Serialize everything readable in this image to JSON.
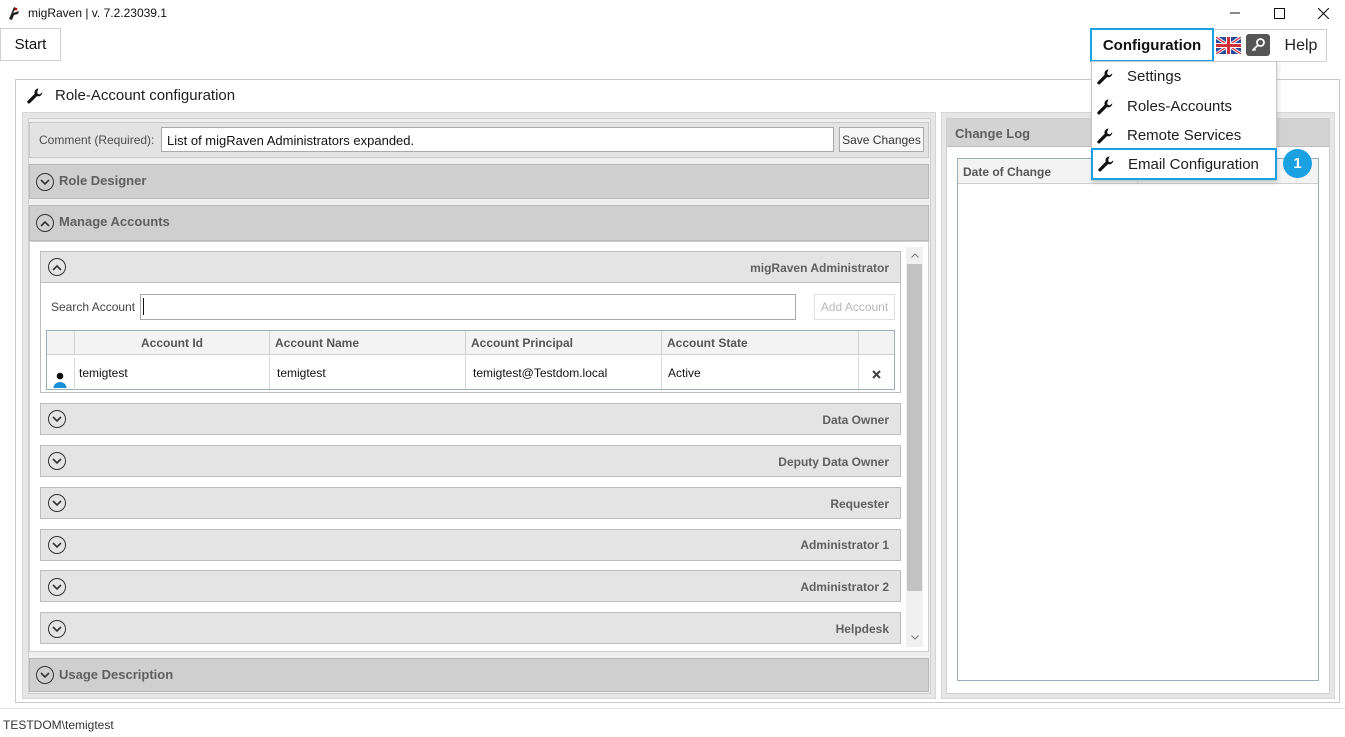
{
  "window": {
    "title": "migRaven | v. 7.2.23039.1",
    "controls": [
      "minimize-icon",
      "maximize-icon",
      "close-icon"
    ]
  },
  "toolbar": {
    "start_label": "Start",
    "configuration_label": "Configuration",
    "language_icon": "uk-flag-icon",
    "key_icon": "key-icon",
    "help_label": "Help"
  },
  "config_menu": {
    "items": [
      {
        "label": "Settings",
        "icon": "wrench-icon"
      },
      {
        "label": "Roles-Accounts",
        "icon": "wrench-icon"
      },
      {
        "label": "Remote Services",
        "icon": "wrench-icon"
      },
      {
        "label": "Email Configuration",
        "icon": "wrench-icon",
        "highlighted": true
      }
    ],
    "step_badge": "1"
  },
  "page": {
    "title": "Role-Account configuration",
    "icon": "wrench-icon"
  },
  "comment": {
    "label": "Comment (Required):",
    "value": "List of migRaven Administrators expanded.",
    "save_label": "Save Changes"
  },
  "sections": {
    "role_designer": "Role Designer",
    "manage_accounts": "Manage Accounts",
    "usage_description": "Usage Description"
  },
  "account_groups": {
    "expanded": {
      "title": "migRaven Administrator",
      "search_label": "Search Account",
      "search_value": "",
      "add_label": "Add Account",
      "columns": [
        "Account Id",
        "Account Name",
        "Account Principal",
        "Account State"
      ],
      "rows": [
        {
          "id": "temigtest",
          "name": "temigtest",
          "principal": "temigtest@Testdom.local",
          "state": "Active",
          "icon": "user-icon",
          "action_icon": "remove-icon"
        }
      ]
    },
    "collapsed": [
      "Data Owner",
      "Deputy Data Owner",
      "Requester",
      "Administrator 1",
      "Administrator 2",
      "Helpdesk"
    ]
  },
  "change_log": {
    "title": "Change Log",
    "columns": [
      "Date of Change",
      ""
    ]
  },
  "status": {
    "user": "TESTDOM\\temigtest"
  },
  "colors": {
    "accent": "#1ba1e2",
    "section_header": "#cfcfcf",
    "panel_bg": "#e6e6e6"
  }
}
